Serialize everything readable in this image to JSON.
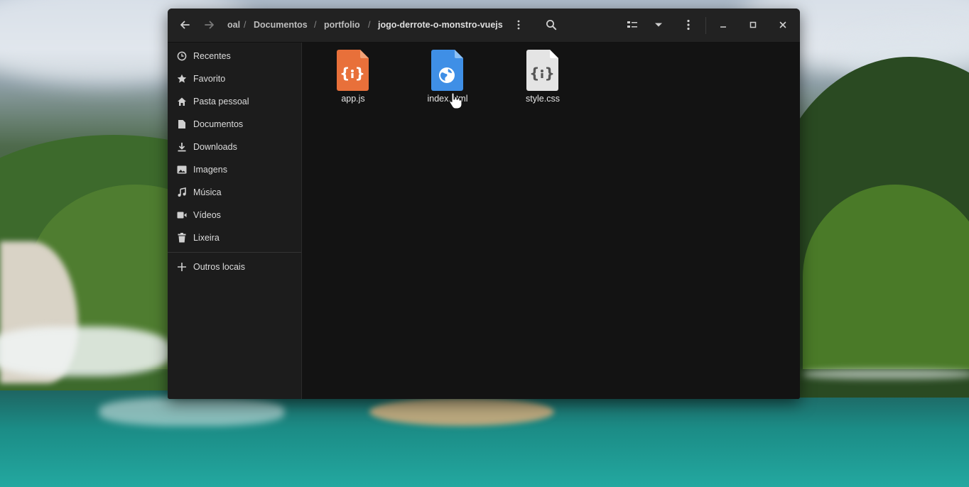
{
  "window": {
    "breadcrumb": [
      {
        "label": "oal",
        "active": false
      },
      {
        "label": "Documentos",
        "active": false
      },
      {
        "label": "portfolio",
        "active": false
      },
      {
        "label": "jogo-derrote-o-monstro-vuejs",
        "active": true
      }
    ],
    "breadcrumb_separator": "/"
  },
  "sidebar": {
    "items": [
      {
        "label": "Recentes",
        "icon": "clock-icon"
      },
      {
        "label": "Favorito",
        "icon": "star-icon"
      },
      {
        "label": "Pasta pessoal",
        "icon": "home-icon"
      },
      {
        "label": "Documentos",
        "icon": "document-icon"
      },
      {
        "label": "Downloads",
        "icon": "download-icon"
      },
      {
        "label": "Imagens",
        "icon": "image-icon"
      },
      {
        "label": "Música",
        "icon": "music-icon"
      },
      {
        "label": "Vídeos",
        "icon": "video-icon"
      },
      {
        "label": "Lixeira",
        "icon": "trash-icon"
      }
    ],
    "other_locations": {
      "label": "Outros locais",
      "icon": "plus-icon"
    }
  },
  "files": [
    {
      "name": "app.js",
      "icon": "javascript-file-icon",
      "color": "#e8703a"
    },
    {
      "name": "index.html",
      "icon": "html-file-icon",
      "color": "#3f8fe6"
    },
    {
      "name": "style.css",
      "icon": "css-file-icon",
      "color": "#e4e4e4"
    }
  ],
  "colors": {
    "header": "#222222",
    "sidebar": "#1c1c1c",
    "content": "#131313",
    "text": "#dcdcdc"
  }
}
